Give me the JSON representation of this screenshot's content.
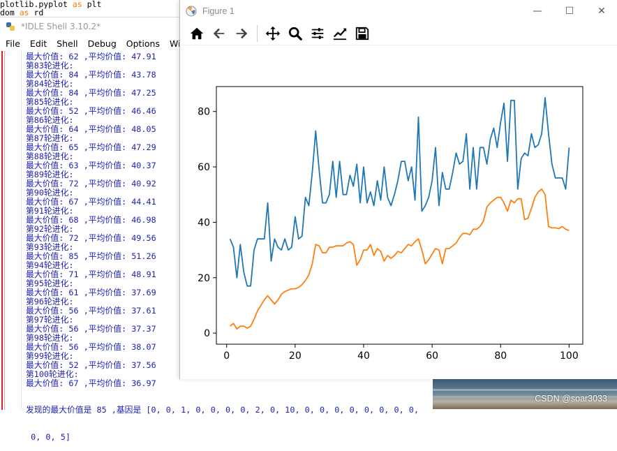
{
  "editor": {
    "line1_a": "plotlib.pyplot ",
    "line1_kw": "as",
    "line1_b": " plt",
    "line2_a": "dom ",
    "line2_kw": "as",
    "line2_b": " rd"
  },
  "idle": {
    "title": "*IDLE Shell 3.10.2*",
    "menu": [
      "File",
      "Edit",
      "Shell",
      "Debug",
      "Options",
      "Wind"
    ],
    "output_lines": [
      "最大价值: 62 ,平均价值: 47.91",
      "第83轮进化:",
      "最大价值: 84 ,平均价值: 43.78",
      "第84轮进化:",
      "最大价值: 84 ,平均价值: 47.25",
      "第85轮进化:",
      "最大价值: 52 ,平均价值: 46.46",
      "第86轮进化:",
      "最大价值: 64 ,平均价值: 48.05",
      "第87轮进化:",
      "最大价值: 65 ,平均价值: 47.29",
      "第88轮进化:",
      "最大价值: 63 ,平均价值: 40.37",
      "第89轮进化:",
      "最大价值: 72 ,平均价值: 40.92",
      "第90轮进化:",
      "最大价值: 67 ,平均价值: 44.41",
      "第91轮进化:",
      "最大价值: 68 ,平均价值: 46.98",
      "第92轮进化:",
      "最大价值: 72 ,平均价值: 49.56",
      "第93轮进化:",
      "最大价值: 85 ,平均价值: 51.26",
      "第94轮进化:",
      "最大价值: 71 ,平均价值: 48.91",
      "第95轮进化:",
      "最大价值: 61 ,平均价值: 37.69",
      "第96轮进化:",
      "最大价值: 56 ,平均价值: 37.61",
      "第97轮进化:",
      "最大价值: 56 ,平均价值: 37.37",
      "第98轮进化:",
      "最大价值: 56 ,平均价值: 38.07",
      "第99轮进化:",
      "最大价值: 52 ,平均价值: 37.56",
      "第100轮进化:",
      "最大价值: 67 ,平均价值: 36.97"
    ],
    "tail_line1": "发现的最大价值是 85 ,基因是 [0, 0, 1, 0, 0, 0, 0, 2, 0, 10, 0, 0, 0, 0, 0, 0, 0, 0,",
    "tail_line2": " 0, 0, 5]"
  },
  "figure": {
    "title": "Figure 1",
    "toolbar": [
      "home-icon",
      "back-arrow-icon",
      "forward-arrow-icon",
      "pan-icon",
      "zoom-icon",
      "configure-subplots-icon",
      "edit-axis-icon",
      "save-icon"
    ],
    "minimize": "—",
    "maximize": "☐",
    "close": "✕"
  },
  "watermark": "CSDN @soar3033",
  "chart_data": {
    "type": "line",
    "xlim": [
      -3,
      104
    ],
    "ylim": [
      -4,
      89
    ],
    "xticks": [
      0,
      20,
      40,
      60,
      80,
      100
    ],
    "yticks": [
      0,
      20,
      40,
      60,
      80
    ],
    "grid": false,
    "series": [
      {
        "color": "#1f77b4",
        "x": [
          1,
          2,
          3,
          4,
          5,
          6,
          7,
          8,
          9,
          10,
          11,
          12,
          13,
          14,
          15,
          16,
          17,
          18,
          19,
          20,
          21,
          22,
          23,
          24,
          25,
          26,
          27,
          28,
          29,
          30,
          31,
          32,
          33,
          34,
          35,
          36,
          37,
          38,
          39,
          40,
          41,
          42,
          43,
          44,
          45,
          46,
          47,
          48,
          49,
          50,
          51,
          52,
          53,
          54,
          55,
          56,
          57,
          58,
          59,
          60,
          61,
          62,
          63,
          64,
          65,
          66,
          67,
          68,
          69,
          70,
          71,
          72,
          73,
          74,
          75,
          76,
          77,
          78,
          79,
          80,
          81,
          82,
          83,
          84,
          85,
          86,
          87,
          88,
          89,
          90,
          91,
          92,
          93,
          94,
          95,
          96,
          97,
          98,
          99,
          100
        ],
        "values": [
          34,
          31,
          20,
          32,
          22,
          17,
          17,
          30,
          34,
          34,
          34,
          47,
          26,
          34,
          31,
          30,
          34,
          30,
          31,
          42,
          34,
          35,
          49,
          46,
          58,
          73,
          59,
          47,
          47,
          50,
          62,
          49,
          62,
          50,
          50,
          57,
          53,
          61,
          47,
          60,
          47,
          51,
          46,
          55,
          48,
          60,
          49,
          46,
          50,
          55,
          62,
          62,
          55,
          60,
          48,
          78,
          44,
          46,
          49,
          55,
          67,
          46,
          58,
          52,
          52,
          58,
          65,
          61,
          62,
          72,
          52,
          67,
          52,
          67,
          67,
          61,
          70,
          74,
          67,
          76,
          83,
          62,
          84,
          84,
          52,
          63,
          65,
          64,
          72,
          67,
          68,
          72,
          85,
          72,
          61,
          56,
          56,
          56,
          52,
          67
        ]
      },
      {
        "color": "#ff7f0e",
        "x": [
          1,
          2,
          3,
          4,
          5,
          6,
          7,
          8,
          9,
          10,
          11,
          12,
          13,
          14,
          15,
          16,
          17,
          18,
          19,
          20,
          21,
          22,
          23,
          24,
          25,
          26,
          27,
          28,
          29,
          30,
          31,
          32,
          33,
          34,
          35,
          36,
          37,
          38,
          39,
          40,
          41,
          42,
          43,
          44,
          45,
          46,
          47,
          48,
          49,
          50,
          51,
          52,
          53,
          54,
          55,
          56,
          57,
          58,
          59,
          60,
          61,
          62,
          63,
          64,
          65,
          66,
          67,
          68,
          69,
          70,
          71,
          72,
          73,
          74,
          75,
          76,
          77,
          78,
          79,
          80,
          81,
          82,
          83,
          84,
          85,
          86,
          87,
          88,
          89,
          90,
          91,
          92,
          93,
          94,
          95,
          96,
          97,
          98,
          99,
          100
        ],
        "values": [
          2.5,
          3.5,
          1.5,
          2.5,
          2.5,
          1.8,
          2.5,
          5,
          8,
          10,
          12,
          13.5,
          12,
          10.5,
          12,
          14,
          15,
          15.5,
          16,
          16,
          16.5,
          17.5,
          19,
          21,
          25,
          32,
          31.5,
          29,
          29,
          31,
          31,
          31.5,
          31.5,
          31.5,
          32.5,
          33,
          32,
          24.5,
          26.5,
          30,
          30,
          32,
          28,
          30.5,
          29.5,
          26,
          28,
          27,
          28,
          29.5,
          29,
          30.5,
          32,
          31.5,
          33,
          34,
          30,
          25,
          26.5,
          28.5,
          30.5,
          30,
          25,
          30.5,
          30.5,
          31.5,
          32.5,
          34.5,
          36,
          36,
          35.5,
          37.5,
          37.5,
          38.5,
          40.5,
          45.5,
          47,
          48,
          49,
          49,
          47,
          44,
          48,
          47,
          48.5,
          48.5,
          41,
          41.5,
          45,
          49,
          51,
          52,
          50,
          38.5,
          38,
          38,
          37.7,
          38.5,
          37.5,
          37
        ]
      }
    ]
  }
}
